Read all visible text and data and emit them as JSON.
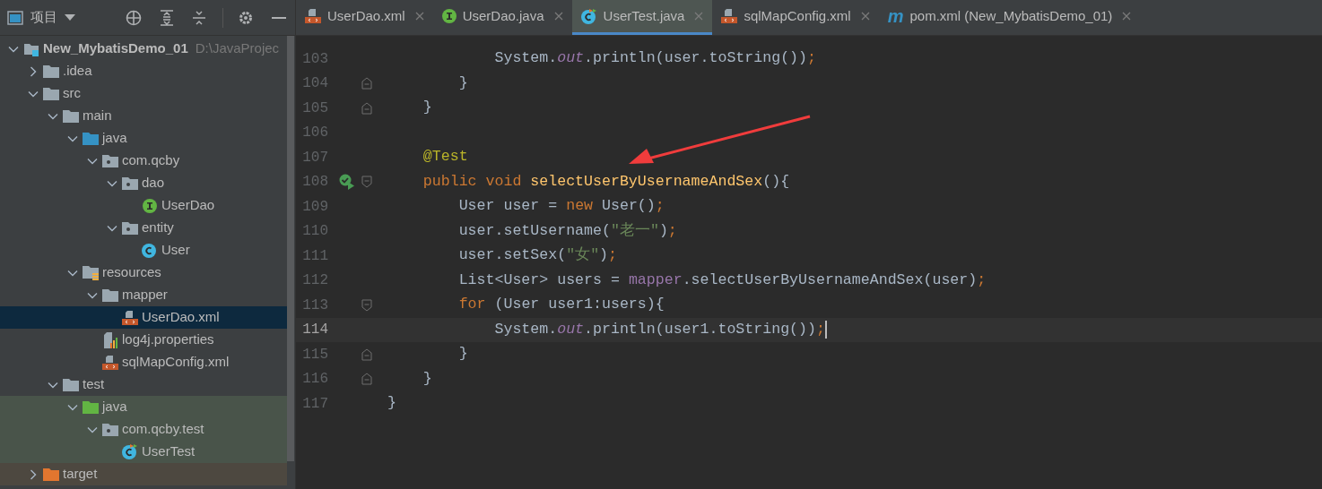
{
  "project_panel": {
    "title": "项目",
    "tree": [
      {
        "label": "New_MybatisDemo_01",
        "path": "D:\\JavaProjec",
        "kind": "module",
        "expanded": true,
        "selected": false,
        "children": [
          {
            "label": ".idea",
            "kind": "folder",
            "expanded": false,
            "selected": false
          },
          {
            "label": "src",
            "kind": "folder",
            "expanded": true,
            "selected": false,
            "children": [
              {
                "label": "main",
                "kind": "folder",
                "expanded": true,
                "selected": false,
                "children": [
                  {
                    "label": "java",
                    "kind": "sources",
                    "expanded": true,
                    "selected": false,
                    "children": [
                      {
                        "label": "com.qcby",
                        "kind": "package",
                        "expanded": true,
                        "selected": false,
                        "children": [
                          {
                            "label": "dao",
                            "kind": "package",
                            "expanded": true,
                            "selected": false,
                            "children": [
                              {
                                "label": "UserDao",
                                "kind": "interface",
                                "selected": false
                              }
                            ]
                          },
                          {
                            "label": "entity",
                            "kind": "package",
                            "expanded": true,
                            "selected": false,
                            "children": [
                              {
                                "label": "User",
                                "kind": "class",
                                "selected": false
                              }
                            ]
                          }
                        ]
                      }
                    ]
                  },
                  {
                    "label": "resources",
                    "kind": "resources",
                    "expanded": true,
                    "selected": false,
                    "children": [
                      {
                        "label": "mapper",
                        "kind": "folder",
                        "expanded": true,
                        "selected": false,
                        "children": [
                          {
                            "label": "UserDao.xml",
                            "kind": "xml",
                            "selected": true
                          }
                        ]
                      },
                      {
                        "label": "log4j.properties",
                        "kind": "properties",
                        "selected": false
                      },
                      {
                        "label": "sqlMapConfig.xml",
                        "kind": "xml",
                        "selected": false
                      }
                    ]
                  }
                ]
              },
              {
                "label": "test",
                "kind": "folder",
                "expanded": true,
                "selected": false,
                "children": [
                  {
                    "label": "java",
                    "kind": "tests",
                    "expanded": true,
                    "selected": false,
                    "color": "#49544a",
                    "children": [
                      {
                        "label": "com.qcby.test",
                        "kind": "package",
                        "expanded": true,
                        "selected": false,
                        "color": "#49544a",
                        "children": [
                          {
                            "label": "UserTest",
                            "kind": "testclass",
                            "selected": false,
                            "color": "#49544a"
                          }
                        ]
                      }
                    ]
                  }
                ]
              }
            ]
          },
          {
            "label": "target",
            "kind": "excluded",
            "expanded": false,
            "selected": false,
            "color": "#4d4840"
          }
        ]
      }
    ]
  },
  "tabs": [
    {
      "label": "UserDao.xml",
      "kind": "xml",
      "selected": false
    },
    {
      "label": "UserDao.java",
      "kind": "interface",
      "selected": false
    },
    {
      "label": "UserTest.java",
      "kind": "testclass",
      "selected": true
    },
    {
      "label": "sqlMapConfig.xml",
      "kind": "xml",
      "selected": false
    },
    {
      "label": "pom.xml (New_MybatisDemo_01)",
      "kind": "maven",
      "glyph": "m",
      "selected": false
    }
  ],
  "editor": {
    "lines": [
      {
        "number": "103",
        "current": false,
        "kind": "plain",
        "tokens": [
          {
            "text": "            System.",
            "kind": "plain"
          },
          {
            "text": "out",
            "kind": "static"
          },
          {
            "text": ".println(user.toString())",
            "kind": "plain"
          },
          {
            "text": ";",
            "kind": "punct"
          }
        ]
      },
      {
        "number": "104",
        "current": false,
        "kind": "closer",
        "tokens": [
          {
            "text": "        }",
            "kind": "plain"
          }
        ]
      },
      {
        "number": "105",
        "current": false,
        "kind": "closer",
        "tokens": [
          {
            "text": "    }",
            "kind": "plain"
          }
        ]
      },
      {
        "number": "106",
        "current": false,
        "kind": "plain"
      },
      {
        "number": "107",
        "current": false,
        "kind": "plain",
        "tokens": [
          {
            "text": "    @Test",
            "kind": "annotation"
          }
        ]
      },
      {
        "number": "108",
        "current": false,
        "kind": "test",
        "tokens": [
          {
            "text": "    public void ",
            "kind": "keyword"
          },
          {
            "text": "selectUserByUsernameAndSex",
            "kind": "method"
          },
          {
            "text": "(){",
            "kind": "plain"
          }
        ]
      },
      {
        "number": "109",
        "current": false,
        "kind": "plain",
        "tokens": [
          {
            "text": "        User user = ",
            "kind": "plain"
          },
          {
            "text": "new",
            "kind": "keyword"
          },
          {
            "text": " User()",
            "kind": "plain"
          },
          {
            "text": ";",
            "kind": "punct"
          }
        ]
      },
      {
        "number": "110",
        "current": false,
        "kind": "plain",
        "tokens": [
          {
            "text": "        user.setUsername(",
            "kind": "plain"
          },
          {
            "text": "\"老一\"",
            "kind": "string"
          },
          {
            "text": ")",
            "kind": "plain"
          },
          {
            "text": ";",
            "kind": "punct"
          }
        ]
      },
      {
        "number": "111",
        "current": false,
        "kind": "plain",
        "tokens": [
          {
            "text": "        user.setSex(",
            "kind": "plain"
          },
          {
            "text": "\"女\"",
            "kind": "string"
          },
          {
            "text": ")",
            "kind": "plain"
          },
          {
            "text": ";",
            "kind": "punct"
          }
        ]
      },
      {
        "number": "112",
        "current": false,
        "kind": "plain",
        "tokens": [
          {
            "text": "        List<User> users = ",
            "kind": "plain"
          },
          {
            "text": "mapper",
            "kind": "field"
          },
          {
            "text": ".selectUserByUsernameAndSex(user)",
            "kind": "plain"
          },
          {
            "text": ";",
            "kind": "punct"
          }
        ]
      },
      {
        "number": "113",
        "current": false,
        "kind": "opener",
        "tokens": [
          {
            "text": "        for",
            "kind": "keyword"
          },
          {
            "text": " (User user1:users){",
            "kind": "plain"
          }
        ]
      },
      {
        "number": "114",
        "current": true,
        "kind": "plain",
        "tokens": [
          {
            "text": "            System.",
            "kind": "plain"
          },
          {
            "text": "out",
            "kind": "static"
          },
          {
            "text": ".println(user1.toString())",
            "kind": "plain"
          },
          {
            "text": ";",
            "kind": "punct"
          }
        ]
      },
      {
        "number": "115",
        "current": false,
        "kind": "closer",
        "tokens": [
          {
            "text": "        }",
            "kind": "plain"
          }
        ]
      },
      {
        "number": "116",
        "current": false,
        "kind": "closer",
        "tokens": [
          {
            "text": "    }",
            "kind": "plain"
          }
        ]
      },
      {
        "number": "117",
        "current": false,
        "kind": "plain",
        "tokens": [
          {
            "text": "}",
            "kind": "plain"
          }
        ]
      }
    ]
  }
}
